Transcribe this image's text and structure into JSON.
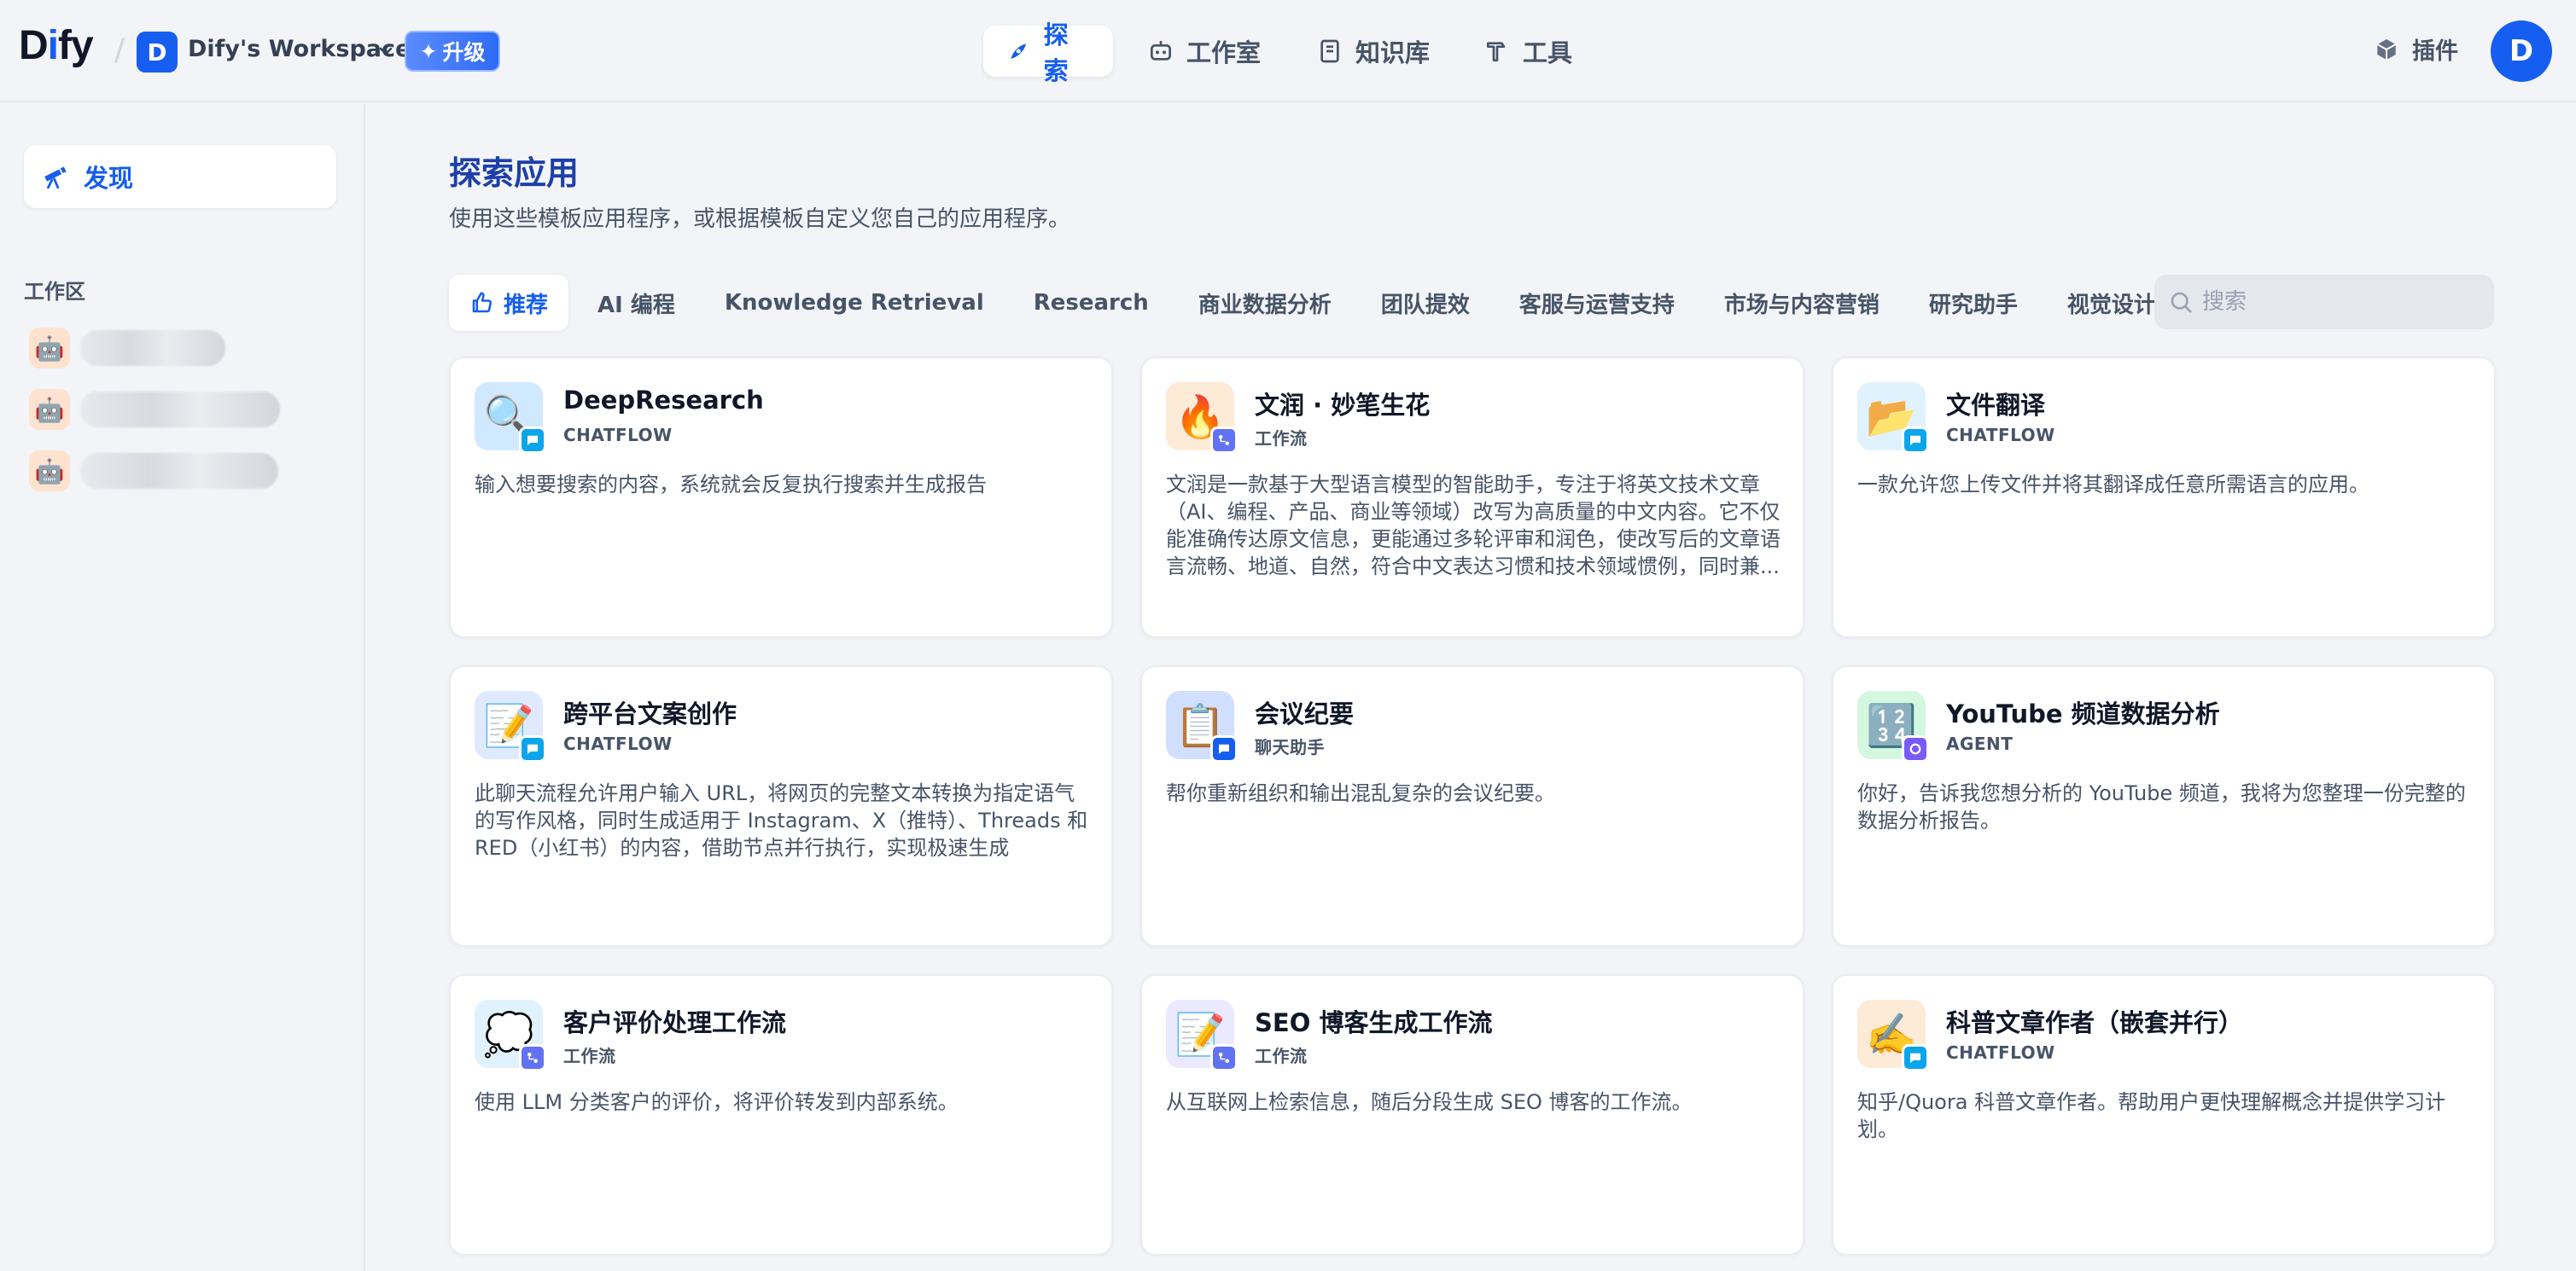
{
  "header": {
    "logo_prefix": "D",
    "logo_i": "i",
    "logo_suffix": "fy",
    "workspace_initial": "D",
    "workspace_name": "Dify's Workspace",
    "upgrade_label": "升级",
    "nav": [
      {
        "label": "探索",
        "icon": "explore-icon"
      },
      {
        "label": "工作室",
        "icon": "robot-icon"
      },
      {
        "label": "知识库",
        "icon": "book-icon"
      },
      {
        "label": "工具",
        "icon": "hammer-icon"
      }
    ],
    "plugins_label": "插件",
    "user_initial": "D"
  },
  "sidebar": {
    "discover_label": "发现",
    "workspace_section_label": "工作区"
  },
  "main": {
    "title": "探索应用",
    "subtitle": "使用这些模板应用程序，或根据模板自定义您自己的应用程序。",
    "search_placeholder": "搜索",
    "tabs": [
      "推荐",
      "AI 编程",
      "Knowledge Retrieval",
      "Research",
      "商业数据分析",
      "团队提效",
      "客服与运营支持",
      "市场与内容营销",
      "研究助手",
      "视觉设计"
    ],
    "cards": [
      {
        "name": "DeepResearch",
        "type": "CHATFLOW",
        "desc": "输入想要搜索的内容，系统就会反复执行搜索并生成报告",
        "emoji": "🔍",
        "icon_bg": "#d1e9ff",
        "badge": "#0ba5ec"
      },
      {
        "name": "文润 · 妙笔生花",
        "type": "工作流",
        "desc": "文润是一款基于大型语言模型的智能助手，专注于将英文技术文章（AI、编程、产品、商业等领域）改写为高质量的中文内容。它不仅能准确传达原文信息，更能通过多轮评审和润色，使改写后的文章语言流畅、地道、自然，符合中文表达习惯和技术领域惯例，同时兼...",
        "emoji": "🔥",
        "icon_bg": "#fdead7",
        "badge": "#6172f3"
      },
      {
        "name": "文件翻译",
        "type": "CHATFLOW",
        "desc": "一款允许您上传文件并将其翻译成任意所需语言的应用。",
        "emoji": "📂",
        "icon_bg": "#e0f2fe",
        "badge": "#0ba5ec"
      },
      {
        "name": "跨平台文案创作",
        "type": "CHATFLOW",
        "desc": "此聊天流程允许用户输入 URL，将网页的完整文本转换为指定语气的写作风格，同时生成适用于 Instagram、X（推特）、Threads 和 RED（小红书）的内容，借助节点并行执行，实现极速生成",
        "emoji": "📝",
        "icon_bg": "#e0eaff",
        "badge": "#0ba5ec"
      },
      {
        "name": "会议纪要",
        "type": "聊天助手",
        "desc": "帮你重新组织和输出混乱复杂的会议纪要。",
        "emoji": "📋",
        "icon_bg": "#d1e0ff",
        "badge": "#155eef"
      },
      {
        "name": "YouTube 频道数据分析",
        "type": "AGENT",
        "desc": "你好，告诉我您想分析的 YouTube 频道，我将为您整理一份完整的数据分析报告。",
        "emoji": "🔢",
        "icon_bg": "#d3f8df",
        "badge": "#7a5af8"
      },
      {
        "name": "客户评价处理工作流",
        "type": "工作流",
        "desc": "使用 LLM 分类客户的评价，将评价转发到内部系统。",
        "emoji": "💭",
        "icon_bg": "#e0f2fe",
        "badge": "#6172f3"
      },
      {
        "name": "SEO 博客生成工作流",
        "type": "工作流",
        "desc": "从互联网上检索信息，随后分段生成 SEO 博客的工作流。",
        "emoji": "📝",
        "icon_bg": "#ebe9fe",
        "badge": "#6172f3"
      },
      {
        "name": "科普文章作者（嵌套并行）",
        "type": "CHATFLOW",
        "desc": "知乎/Quora 科普文章作者。帮助用户更快理解概念并提供学习计划。",
        "emoji": "✍️",
        "icon_bg": "#fdead7",
        "badge": "#0ba5ec"
      }
    ]
  },
  "colors": {
    "accent": "#155eef",
    "title": "#1d3fa8",
    "bg": "#f2f4f7"
  }
}
